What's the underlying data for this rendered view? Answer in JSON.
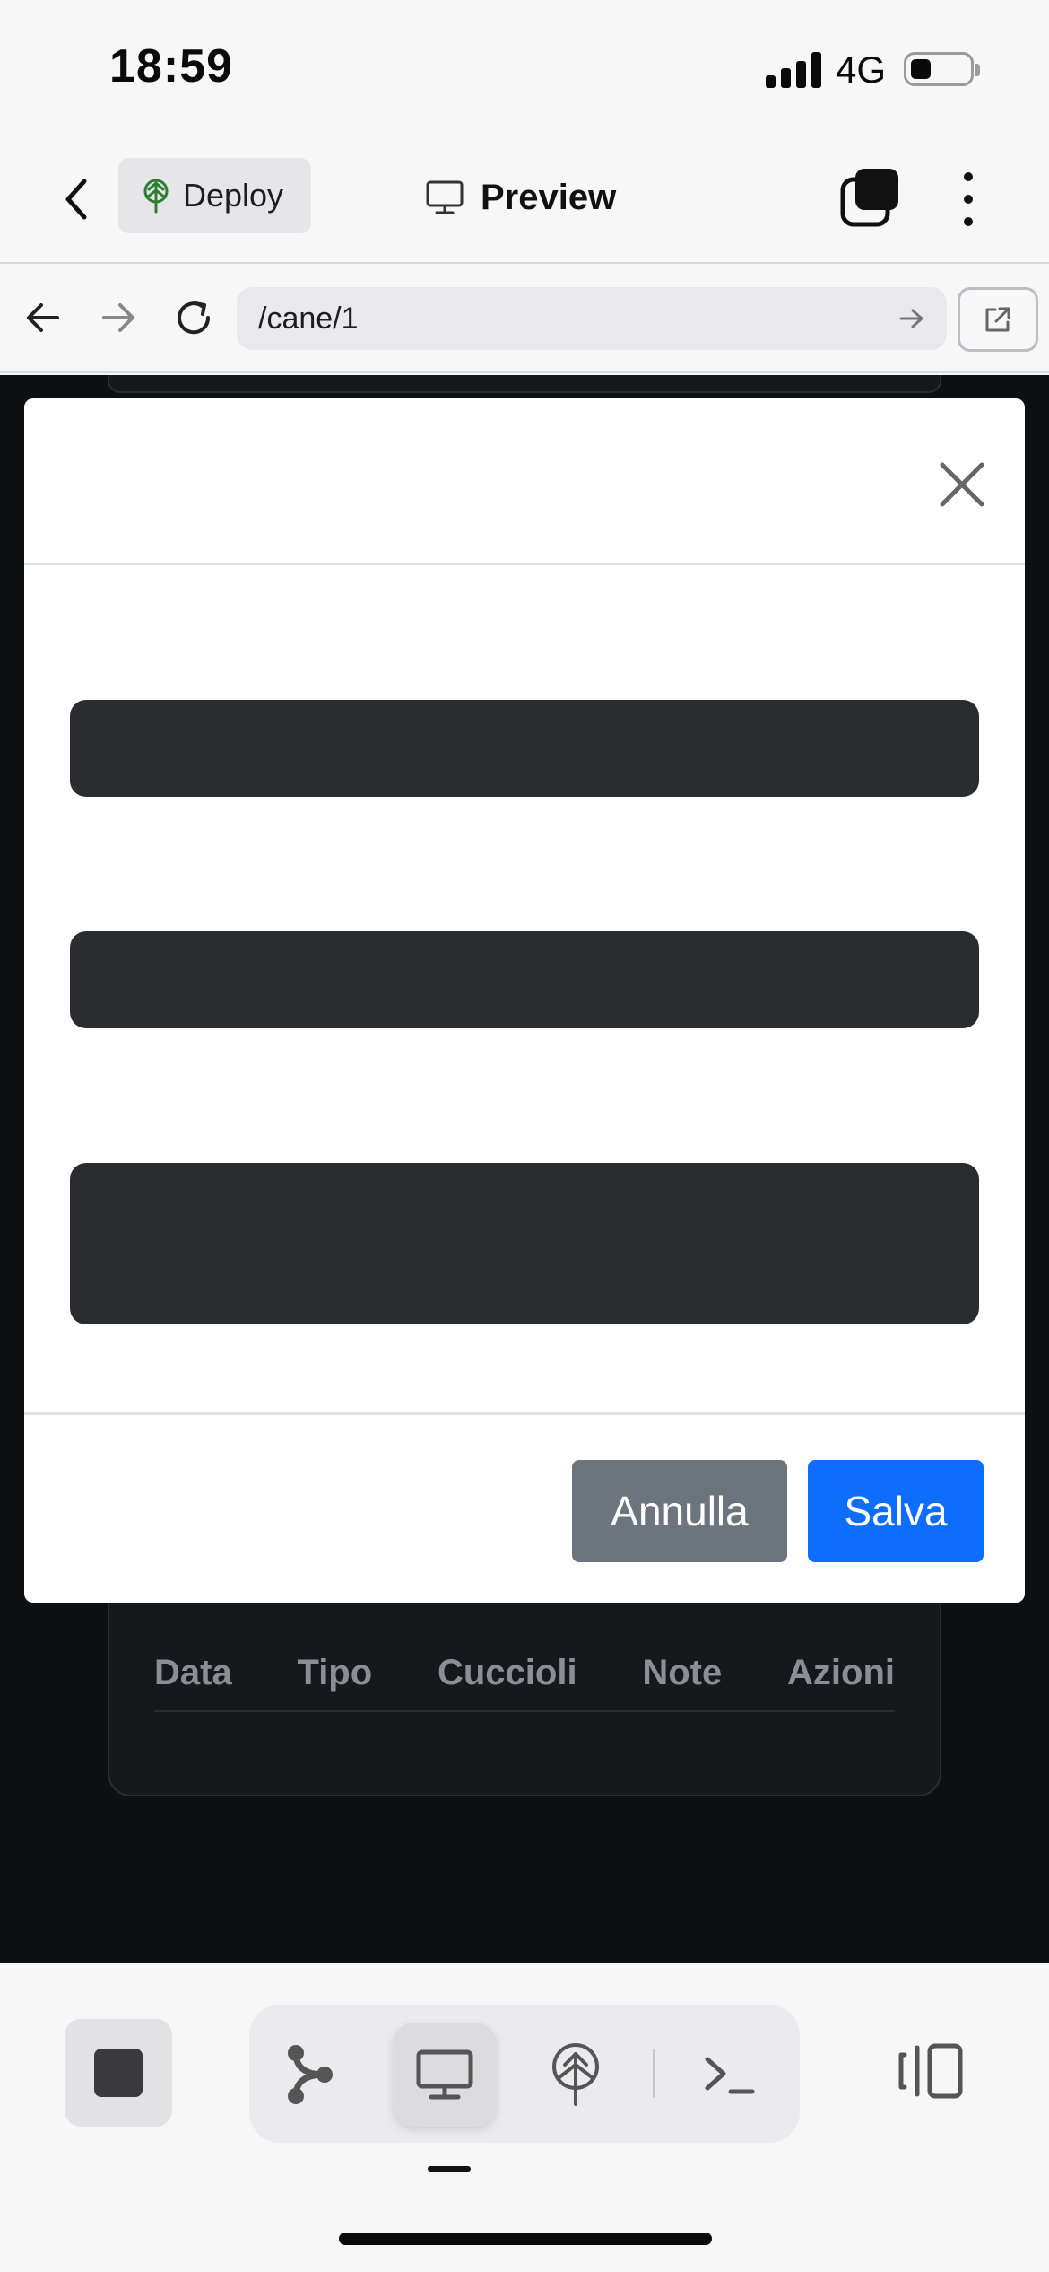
{
  "status_bar": {
    "time": "18:59",
    "network": "4G"
  },
  "header": {
    "deploy_label": "Deploy",
    "title": "Preview"
  },
  "browser": {
    "url": "/cane/1"
  },
  "table": {
    "columns": [
      "Data",
      "Tipo",
      "Cuccioli",
      "Note",
      "Azioni"
    ]
  },
  "modal": {
    "cancel_label": "Annulla",
    "save_label": "Salva"
  },
  "colors": {
    "primary": "#0d6efd",
    "secondary": "#6c757d",
    "page_background": "#0e0f11",
    "deploy_accent": "#2e7d32"
  },
  "icons": {
    "back": "chevron-left-icon",
    "deploy": "deploy-tree-icon",
    "preview": "monitor-icon",
    "windows": "window-stack-icon",
    "more": "more-vertical-icon",
    "close": "close-icon",
    "browser_back": "arrow-left-icon",
    "browser_forward": "arrow-right-icon",
    "reload": "reload-icon",
    "go": "arrow-right-icon",
    "open_external": "external-link-icon",
    "stop": "stop-square-icon",
    "git": "git-branch-icon",
    "terminal": "terminal-icon",
    "panel": "panel-toggle-icon"
  }
}
